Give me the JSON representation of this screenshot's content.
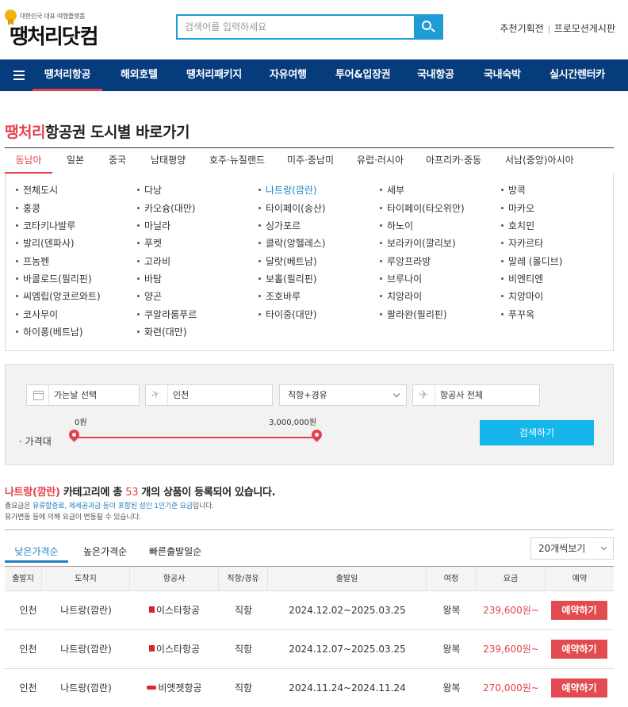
{
  "header": {
    "logo_tagline": "대한민국 대표 여행플랫폼",
    "logo_name": "땡처리",
    "logo_name_tail": "닷컴",
    "search_placeholder": "검색어를 입력하세요",
    "links": [
      "추천기획전",
      "프로모션게시판"
    ]
  },
  "nav": {
    "items": [
      "땡처리항공",
      "해외호텔",
      "땡처리패키지",
      "자유여행",
      "투어&입장권",
      "국내항공",
      "국내숙박",
      "실시간렌터카"
    ],
    "active_index": 0
  },
  "page": {
    "title_red": "땡처리",
    "title_rest": "항공권 도시별 바로가기"
  },
  "region_tabs": [
    "동남아",
    "일본",
    "중국",
    "남태평양",
    "호주·뉴질랜드",
    "미주·중남미",
    "유럽·러시아",
    "아프리카·중동",
    "서남(중앙)아시아"
  ],
  "cities": [
    [
      "전체도시",
      "홍콩",
      "코타키나발루",
      "발리(덴파사)",
      "프놈펜",
      "바콜로드(필리핀)",
      "씨엠립(앙코르와트)",
      "코사무이",
      "하이퐁(베트남)"
    ],
    [
      "다낭",
      "카오슝(대만)",
      "마닐라",
      "푸켓",
      "고라비",
      "바탐",
      "양곤",
      "쿠알라룸푸르",
      "화련(대만)"
    ],
    [
      "나트랑(깜란)",
      "타이페이(송산)",
      "싱가포르",
      "클락(앙헬레스)",
      "달랏(베트남)",
      "보홀(필리핀)",
      "조호바루",
      "타이중(대만)"
    ],
    [
      "세부",
      "타이페이(타오위안)",
      "하노이",
      "보라카이(깔리보)",
      "루앙프라방",
      "브루나이",
      "치앙라이",
      "팔라완(필리핀)"
    ],
    [
      "방콕",
      "마카오",
      "호치민",
      "자카르타",
      "말레 (몰디브)",
      "비엔티엔",
      "치앙마이",
      "푸꾸옥"
    ]
  ],
  "selected_city": "나트랑(깜란)",
  "filter": {
    "date": "가는날 선택",
    "departure": "인천",
    "route_type": "직항+경유",
    "airline": "항공사 전체",
    "price_label": "· 가격대",
    "price_min": "0원",
    "price_max": "3,000,000원",
    "search_button": "검색하기"
  },
  "summary": {
    "category": "나트랑(깜란)",
    "text_before": " 카테고리에 총 ",
    "count": "53",
    "text_after": " 개의 상품이 등록되어 있습니다.",
    "note1_pre": "총요금은 ",
    "note1_blue": "유류할증료, 제세공과금 등이 포함된 성인 1인기준 요금",
    "note1_post": "입니다.",
    "note2": "유가변동 등에 의해 요금이 변동될 수 있습니다."
  },
  "sort_tabs": [
    "낮은가격순",
    "높은가격순",
    "빠른출발일순"
  ],
  "per_page": "20개씩보기",
  "table": {
    "headers": [
      "출발지",
      "도착지",
      "항공사",
      "직항/경유",
      "출발일",
      "여정",
      "요금",
      "예약"
    ],
    "rows": [
      {
        "from": "인천",
        "to": "나트랑(깜란)",
        "airline": "이스타항공",
        "airline_icon": "eastar-logo-icon",
        "type": "직항",
        "dates": "2024.12.02~2025.03.25",
        "trip": "왕복",
        "price": "239,600원~",
        "book": "예약하기"
      },
      {
        "from": "인천",
        "to": "나트랑(깜란)",
        "airline": "이스타항공",
        "airline_icon": "eastar-logo-icon",
        "type": "직항",
        "dates": "2024.12.07~2025.03.25",
        "trip": "왕복",
        "price": "239,600원~",
        "book": "예약하기"
      },
      {
        "from": "인천",
        "to": "나트랑(깜란)",
        "airline": "비엣젯항공",
        "airline_icon": "vietjet-logo-icon",
        "type": "직항",
        "dates": "2024.11.24~2024.11.24",
        "trip": "왕복",
        "price": "270,000원~",
        "book": "예약하기"
      }
    ]
  },
  "colors": {
    "brand_red": "#e6414b",
    "nav_blue": "#063c7c",
    "accent_blue": "#1f9bd6",
    "search_button": "#16b5ec"
  }
}
